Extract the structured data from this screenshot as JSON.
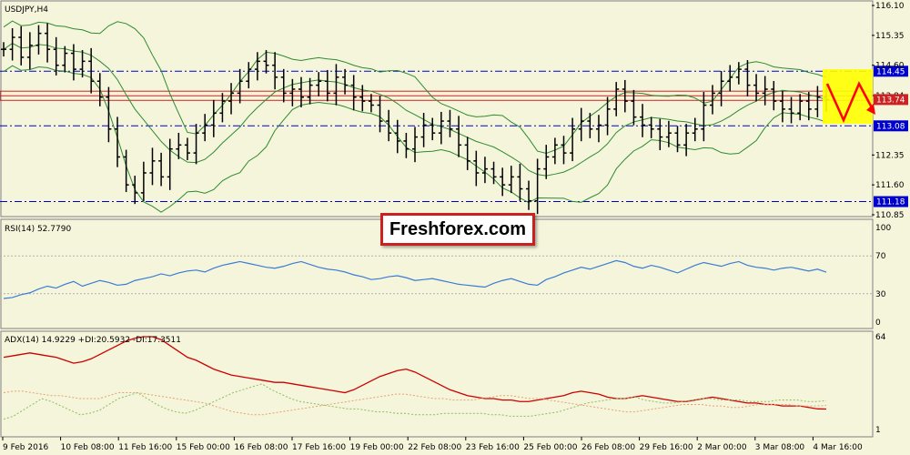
{
  "watermark": "Freshforex.com",
  "colors": {
    "background": "#f5f5dc",
    "candle": "#000000",
    "bollinger": "#2e8b2e",
    "level_line": "#0000cc",
    "resistance_band": "#cc2222",
    "rsi": "#3a7bd5",
    "adx": "#cc0000",
    "di_plus": "#8fbc5a",
    "di_minus": "#e8a070",
    "highlight_box": "#ffff00",
    "forecast_arrow": "#ff0000"
  },
  "chart_data": [
    {
      "type": "candlestick",
      "panel": "price",
      "label": "USDJPY,H4",
      "ylim": [
        110.85,
        116.1
      ],
      "y_ticks": [
        "116.10",
        "115.35",
        "114.60",
        "113.84",
        "113.08",
        "112.35",
        "111.60",
        "110.85"
      ],
      "x_ticks": [
        "9 Feb 2016",
        "10 Feb 08:00",
        "11 Feb 16:00",
        "15 Feb 00:00",
        "16 Feb 08:00",
        "17 Feb 16:00",
        "19 Feb 00:00",
        "22 Feb 08:00",
        "23 Feb 16:00",
        "25 Feb 00:00",
        "26 Feb 08:00",
        "29 Feb 16:00",
        "2 Mar 00:00",
        "3 Mar 08:00",
        "4 Mar 16:00"
      ],
      "levels": [
        {
          "label": "114.45",
          "value": 114.45
        },
        {
          "label": "113.08",
          "value": 113.08
        },
        {
          "label": "111.18",
          "value": 111.18
        }
      ],
      "current_price": {
        "label": "113.74",
        "value": 113.74
      },
      "resistance_band": [
        113.72,
        113.95
      ],
      "close_series": [
        115.0,
        115.3,
        114.8,
        115.1,
        115.4,
        115.0,
        114.6,
        114.9,
        114.5,
        114.7,
        114.2,
        113.8,
        113.0,
        112.3,
        111.6,
        111.4,
        111.9,
        112.2,
        111.8,
        112.5,
        112.6,
        112.4,
        112.9,
        113.1,
        113.4,
        113.7,
        113.9,
        114.2,
        114.5,
        114.7,
        114.6,
        114.3,
        113.9,
        114.0,
        113.8,
        114.1,
        114.2,
        113.9,
        114.3,
        114.1,
        113.8,
        113.7,
        113.6,
        113.2,
        112.9,
        112.7,
        112.5,
        112.8,
        113.1,
        112.9,
        113.2,
        113.0,
        112.6,
        112.2,
        111.9,
        112.0,
        111.8,
        111.6,
        111.8,
        111.5,
        111.2,
        112.0,
        112.3,
        112.6,
        112.4,
        113.0,
        113.2,
        113.0,
        113.1,
        113.5,
        114.0,
        113.7,
        113.3,
        113.1,
        113.0,
        112.8,
        112.9,
        112.6,
        112.9,
        113.0,
        113.6,
        113.9,
        114.2,
        114.3,
        114.5,
        114.1,
        113.9,
        114.0,
        113.7,
        113.5,
        113.4,
        113.7,
        113.5,
        113.8,
        113.74
      ]
    },
    {
      "type": "line",
      "panel": "rsi",
      "label": "RSI(14) 52.7790",
      "ylim": [
        0,
        100
      ],
      "y_ticks": [
        "100",
        "70",
        "30",
        "0"
      ],
      "levels": [
        70,
        30
      ],
      "series": [
        {
          "name": "RSI(14)",
          "values": [
            25,
            26,
            29,
            31,
            35,
            38,
            36,
            40,
            43,
            38,
            41,
            44,
            42,
            39,
            40,
            44,
            46,
            48,
            51,
            49,
            52,
            54,
            55,
            53,
            57,
            60,
            62,
            64,
            62,
            60,
            58,
            57,
            59,
            62,
            64,
            61,
            58,
            56,
            55,
            53,
            50,
            48,
            45,
            46,
            48,
            49,
            47,
            44,
            45,
            46,
            44,
            42,
            40,
            39,
            38,
            37,
            41,
            44,
            46,
            43,
            40,
            39,
            45,
            48,
            52,
            55,
            58,
            56,
            59,
            62,
            65,
            63,
            59,
            57,
            60,
            58,
            55,
            52,
            56,
            60,
            63,
            61,
            59,
            62,
            64,
            60,
            58,
            57,
            55,
            57,
            58,
            56,
            54,
            56,
            52.78
          ]
        }
      ]
    },
    {
      "type": "line",
      "panel": "adx",
      "label": "ADX(14) 14.9229 +DI:20.5932 -DI:17.3511",
      "ylim": [
        1,
        64
      ],
      "y_ticks": [
        "64",
        "1"
      ],
      "series": [
        {
          "name": "ADX(14)",
          "values": [
            50,
            51,
            52,
            53,
            52,
            51,
            50,
            48,
            46,
            47,
            49,
            52,
            55,
            58,
            61,
            63,
            64,
            64,
            62,
            58,
            54,
            50,
            48,
            45,
            42,
            40,
            38,
            37,
            36,
            35,
            34,
            33,
            33,
            32,
            31,
            30,
            29,
            28,
            27,
            26,
            28,
            31,
            34,
            37,
            39,
            41,
            42,
            40,
            37,
            34,
            31,
            28,
            26,
            24,
            23,
            22,
            22,
            21,
            21,
            20,
            20,
            21,
            22,
            23,
            24,
            26,
            27,
            26,
            25,
            23,
            22,
            22,
            23,
            24,
            23,
            22,
            21,
            20,
            20,
            21,
            22,
            23,
            22,
            21,
            20,
            19,
            19,
            18,
            18,
            17,
            17,
            17,
            16,
            15,
            14.92
          ]
        },
        {
          "name": "+DI",
          "values": [
            8,
            10,
            14,
            18,
            22,
            20,
            17,
            14,
            11,
            12,
            14,
            18,
            22,
            24,
            26,
            22,
            18,
            15,
            13,
            12,
            14,
            17,
            20,
            23,
            26,
            28,
            30,
            32,
            28,
            25,
            22,
            20,
            19,
            18,
            17,
            16,
            15,
            15,
            14,
            13,
            13,
            12,
            12,
            11,
            11,
            11,
            12,
            12,
            12,
            12,
            12,
            11,
            11,
            10,
            10,
            10,
            11,
            12,
            13,
            15,
            17,
            19,
            20,
            21,
            22,
            22,
            23,
            21,
            20,
            19,
            19,
            20,
            21,
            22,
            22,
            21,
            21,
            21,
            20,
            20,
            20,
            21,
            21,
            21,
            20,
            20,
            20.59
          ]
        },
        {
          "name": "-DI",
          "values": [
            26,
            27,
            27,
            26,
            25,
            24,
            24,
            23,
            22,
            22,
            22,
            24,
            26,
            26,
            26,
            25,
            24,
            23,
            22,
            21,
            20,
            19,
            17,
            15,
            13,
            12,
            11,
            11,
            12,
            13,
            14,
            15,
            16,
            17,
            18,
            19,
            20,
            21,
            22,
            23,
            24,
            25,
            25,
            24,
            23,
            22,
            22,
            21,
            21,
            21,
            22,
            23,
            24,
            24,
            23,
            22,
            22,
            21,
            20,
            19,
            18,
            17,
            16,
            15,
            14,
            13,
            13,
            14,
            15,
            16,
            17,
            18,
            18,
            18,
            17,
            17,
            16,
            16,
            17,
            18,
            18,
            18,
            18,
            17,
            17,
            17,
            17.35
          ]
        }
      ]
    }
  ]
}
